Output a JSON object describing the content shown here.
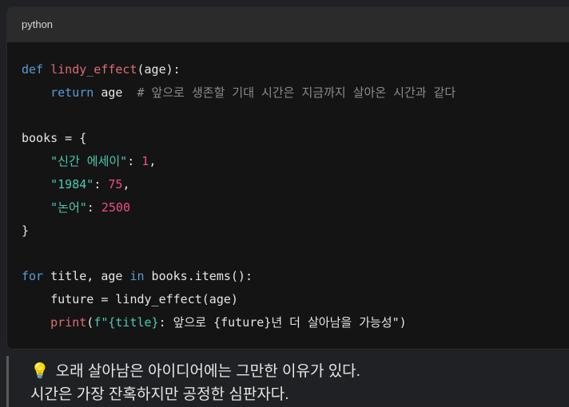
{
  "code_block": {
    "language_label": "python",
    "lines": [
      [
        {
          "t": "def",
          "c": "kw"
        },
        {
          "t": " ",
          "c": "txt"
        },
        {
          "t": "lindy_effect",
          "c": "fn"
        },
        {
          "t": "(age):",
          "c": "txt"
        }
      ],
      [
        {
          "t": "    ",
          "c": "txt"
        },
        {
          "t": "return",
          "c": "kw"
        },
        {
          "t": " age  ",
          "c": "txt"
        },
        {
          "t": "# 앞으로 생존할 기대 시간은 지금까지 살아온 시간과 같다",
          "c": "cm"
        }
      ],
      [],
      [
        {
          "t": "books = {",
          "c": "txt"
        }
      ],
      [
        {
          "t": "    ",
          "c": "txt"
        },
        {
          "t": "\"신간 에세이\"",
          "c": "str"
        },
        {
          "t": ": ",
          "c": "txt"
        },
        {
          "t": "1",
          "c": "num"
        },
        {
          "t": ",",
          "c": "txt"
        }
      ],
      [
        {
          "t": "    ",
          "c": "txt"
        },
        {
          "t": "\"1984\"",
          "c": "str"
        },
        {
          "t": ": ",
          "c": "txt"
        },
        {
          "t": "75",
          "c": "num"
        },
        {
          "t": ",",
          "c": "txt"
        }
      ],
      [
        {
          "t": "    ",
          "c": "txt"
        },
        {
          "t": "\"논어\"",
          "c": "str"
        },
        {
          "t": ": ",
          "c": "txt"
        },
        {
          "t": "2500",
          "c": "num"
        }
      ],
      [
        {
          "t": "}",
          "c": "txt"
        }
      ],
      [],
      [
        {
          "t": "for",
          "c": "kw"
        },
        {
          "t": " title, age ",
          "c": "txt"
        },
        {
          "t": "in",
          "c": "kw"
        },
        {
          "t": " books.items():",
          "c": "txt"
        }
      ],
      [
        {
          "t": "    future = lindy_effect(age)",
          "c": "txt"
        }
      ],
      [
        {
          "t": "    ",
          "c": "txt"
        },
        {
          "t": "print",
          "c": "fn"
        },
        {
          "t": "(",
          "c": "txt"
        },
        {
          "t": "f\"{title}",
          "c": "fstr"
        },
        {
          "t": ": 앞으로 {future}년 더 살아남을 가능성\")",
          "c": "txt"
        }
      ]
    ]
  },
  "note": {
    "icon": "lightbulb-icon",
    "emoji": "💡",
    "line1": "오래 살아남은 아이디어에는 그만한 이유가 있다.",
    "line2": "시간은 가장 잔혹하지만 공정한 심판자다."
  }
}
